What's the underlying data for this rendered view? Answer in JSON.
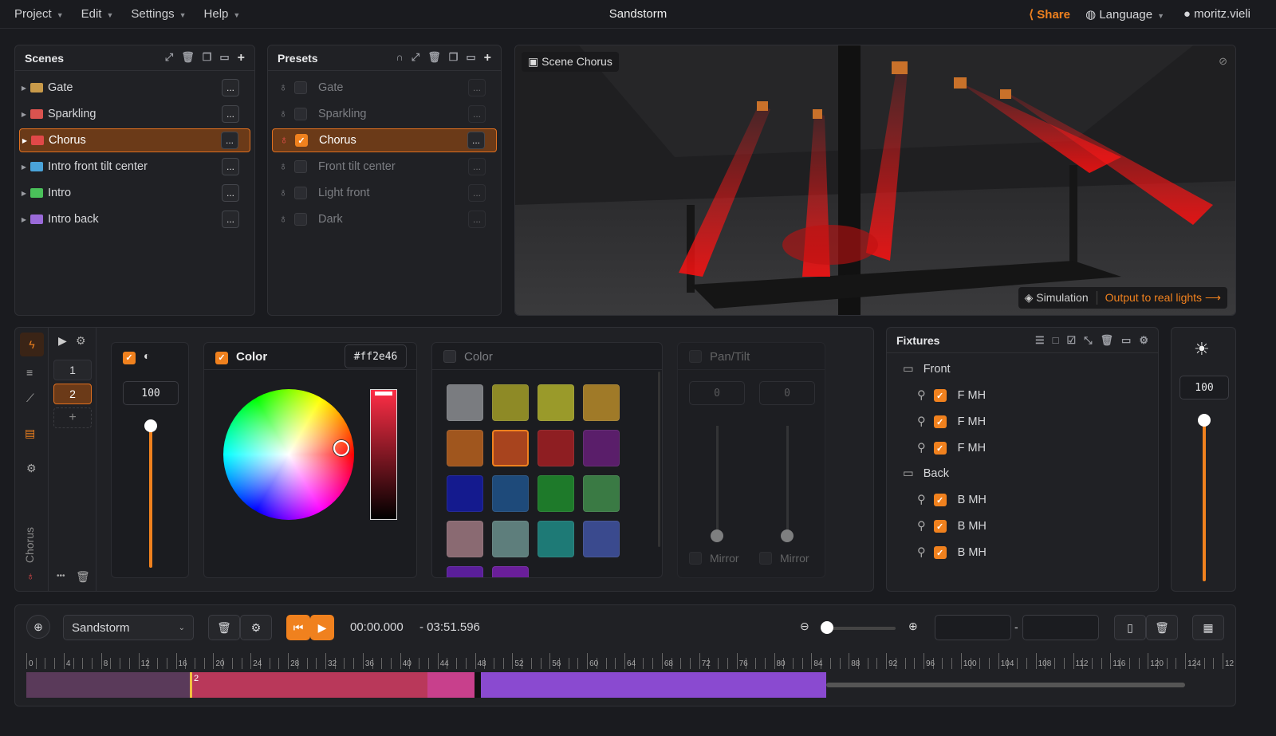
{
  "menu": {
    "items": [
      "Project",
      "Edit",
      "Settings",
      "Help"
    ],
    "title": "Sandstorm",
    "share": "Share",
    "language": "Language",
    "user": "moritz.vieli"
  },
  "scenes": {
    "title": "Scenes",
    "items": [
      {
        "label": "Gate",
        "color": "#c89a4a"
      },
      {
        "label": "Sparkling",
        "color": "#d9534f"
      },
      {
        "label": "Chorus",
        "color": "#e04848"
      },
      {
        "label": "Intro front tilt center",
        "color": "#4aa3d9"
      },
      {
        "label": "Intro",
        "color": "#4ac05a"
      },
      {
        "label": "Intro back",
        "color": "#9a6ad9"
      }
    ],
    "dots": "..."
  },
  "presets": {
    "title": "Presets",
    "items": [
      "Gate",
      "Sparkling",
      "Chorus",
      "Front tilt center",
      "Light front",
      "Dark"
    ],
    "dots": "..."
  },
  "preview": {
    "label": "Scene Chorus",
    "simulation": "Simulation",
    "output": "Output to real lights ⟶"
  },
  "editor": {
    "steps": [
      "1",
      "2"
    ],
    "plus": "+",
    "vertical_label": "Chorus",
    "more": "•••",
    "dimmer_value": "100",
    "color_title": "Color",
    "color_hex": "#ff2e46",
    "color2_title": "Color",
    "pantilt_title": "Pan/Tilt",
    "pan_value": "0",
    "tilt_value": "0",
    "mirror": "Mirror"
  },
  "swatches": [
    "#7a7c80",
    "#8e8a26",
    "#9a9a2a",
    "#a07a28",
    "#a0561e",
    "#a8441e",
    "#8e1e22",
    "#5a1e6a",
    "#141a8e",
    "#1e4a7a",
    "#1e7a2a",
    "#3a7a44",
    "#8a6a72",
    "#5e7e7c",
    "#1e7a76",
    "#3a4a8e",
    "#5a1e9a",
    "#6a1e9a"
  ],
  "fixtures": {
    "title": "Fixtures",
    "groups": [
      {
        "name": "Front",
        "items": [
          "F MH",
          "F MH",
          "F MH"
        ]
      },
      {
        "name": "Back",
        "items": [
          "B MH",
          "B MH",
          "B MH"
        ]
      }
    ]
  },
  "master": {
    "value": "100"
  },
  "timeline": {
    "song": "Sandstorm",
    "time": "00:00.000",
    "duration": "- 03:51.596",
    "sep": "-",
    "ticks": [
      "0",
      "4",
      "8",
      "12",
      "16",
      "20",
      "24",
      "28",
      "32",
      "36",
      "40",
      "44",
      "48",
      "52",
      "56",
      "60",
      "64",
      "68",
      "72",
      "76",
      "80",
      "84",
      "88",
      "92",
      "96",
      "100",
      "104",
      "108",
      "112",
      "116",
      "120",
      "124",
      "12"
    ],
    "marker": "2"
  }
}
